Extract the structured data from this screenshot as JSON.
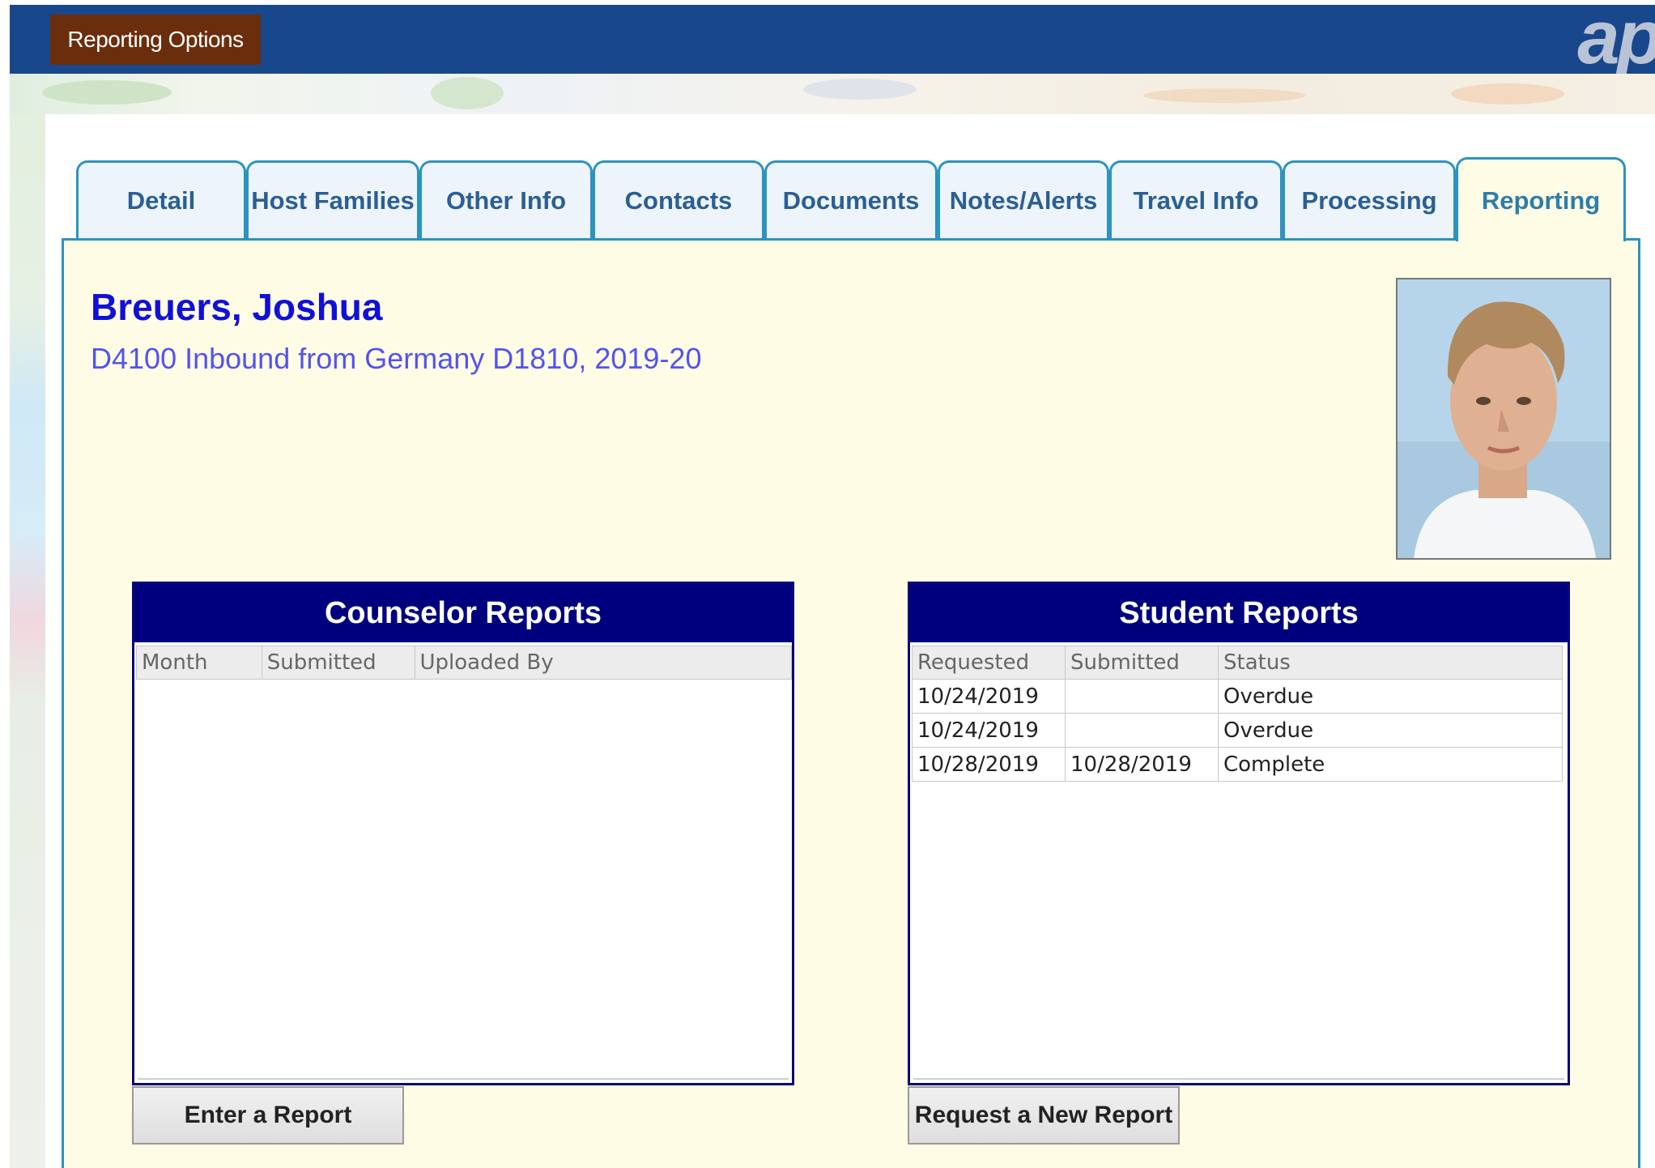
{
  "topbar": {
    "menu_button_label": "Reporting Options",
    "logo_text": "ap"
  },
  "tabs": [
    {
      "label": "Detail",
      "active": false
    },
    {
      "label": "Host Families",
      "active": false
    },
    {
      "label": "Other Info",
      "active": false
    },
    {
      "label": "Contacts",
      "active": false
    },
    {
      "label": "Documents",
      "active": false
    },
    {
      "label": "Notes/Alerts",
      "active": false
    },
    {
      "label": "Travel Info",
      "active": false
    },
    {
      "label": "Processing",
      "active": false
    },
    {
      "label": "Reporting",
      "active": true
    }
  ],
  "student": {
    "name": "Breuers, Joshua",
    "subtitle": "D4100 Inbound from Germany D1810, 2019-20"
  },
  "counselor_reports": {
    "title": "Counselor Reports",
    "columns": [
      "Month",
      "Submitted",
      "Uploaded By"
    ],
    "rows": [],
    "button_label": "Enter a Report"
  },
  "student_reports": {
    "title": "Student Reports",
    "columns": [
      "Requested",
      "Submitted",
      "Status"
    ],
    "rows": [
      [
        "10/24/2019",
        "",
        "Overdue"
      ],
      [
        "10/24/2019",
        "",
        "Overdue"
      ],
      [
        "10/28/2019",
        "10/28/2019",
        "Complete"
      ]
    ],
    "button_label": "Request a New Report"
  },
  "colors": {
    "topbar": "#19478c",
    "menu_button": "#6b2e0c",
    "tab_border": "#2b94bf",
    "content_bg": "#fffce6",
    "panel_header": "#00007e",
    "name_color": "#1010d8"
  }
}
